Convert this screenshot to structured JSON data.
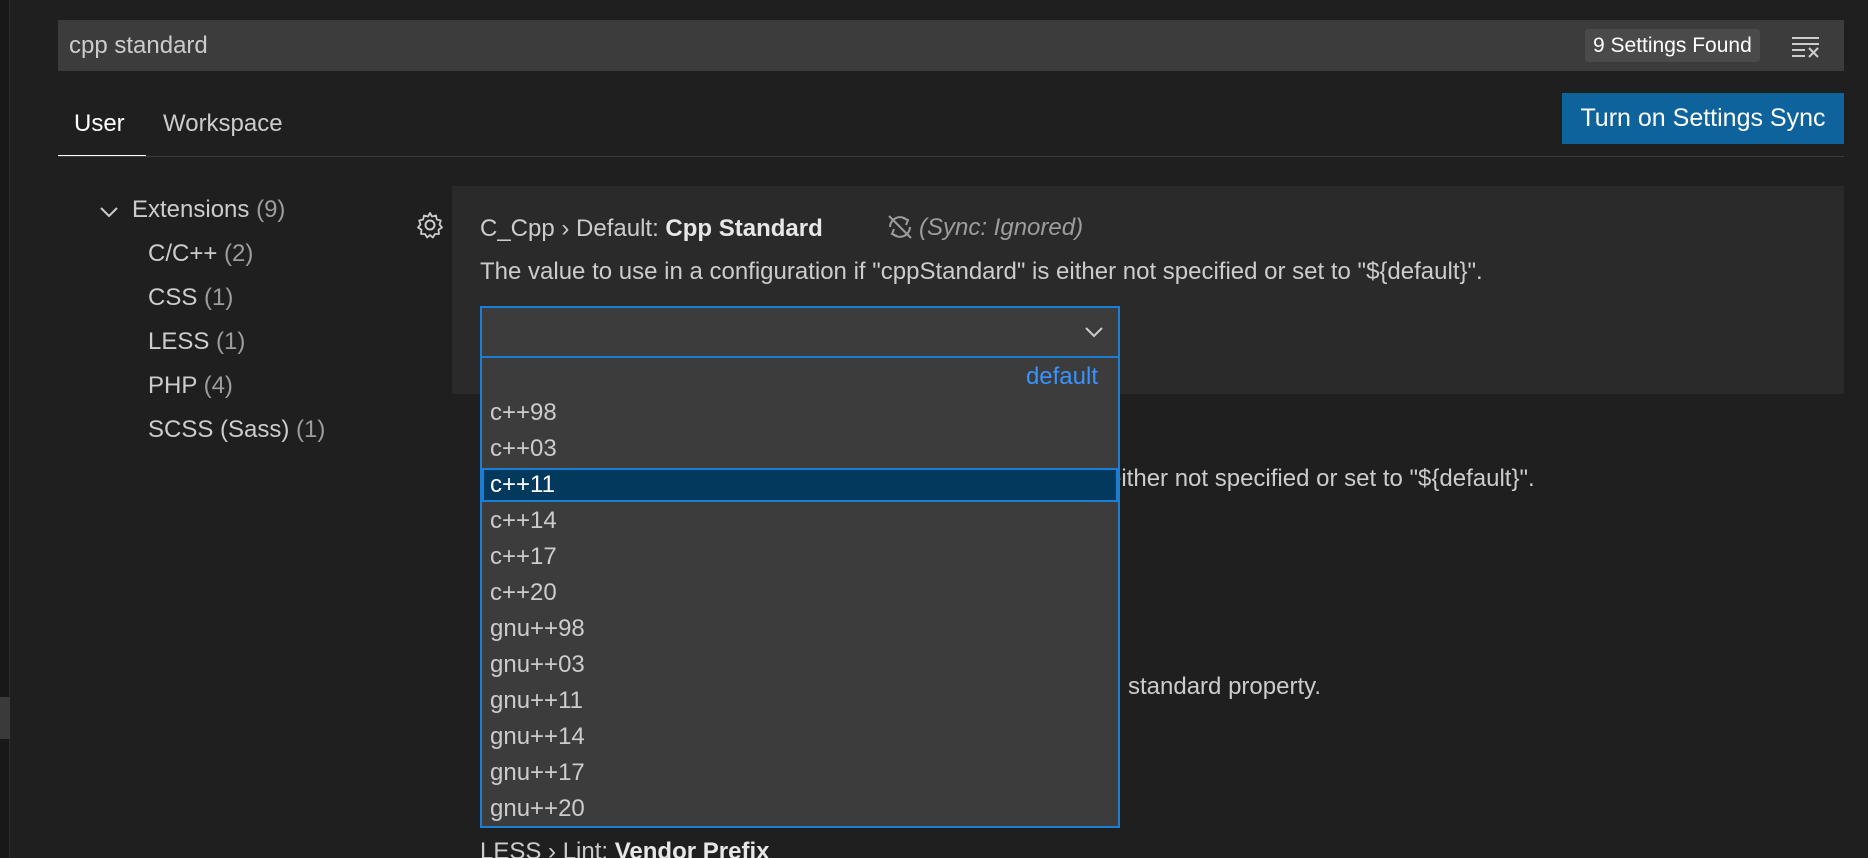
{
  "search": {
    "value": "cpp standard",
    "result_count": "9 Settings Found",
    "clear_icon": "clear-filter-icon"
  },
  "tabs": [
    {
      "label": "User",
      "active": true
    },
    {
      "label": "Workspace",
      "active": false
    }
  ],
  "sync_button_label": "Turn on Settings Sync",
  "toc": {
    "group": {
      "label": "Extensions",
      "count": "(9)"
    },
    "items": [
      {
        "label": "C/C++",
        "count": "(2)"
      },
      {
        "label": "CSS",
        "count": "(1)"
      },
      {
        "label": "LESS",
        "count": "(1)"
      },
      {
        "label": "PHP",
        "count": "(4)"
      },
      {
        "label": "SCSS (Sass)",
        "count": "(1)"
      }
    ]
  },
  "setting": {
    "category": "C_Cpp › Default: ",
    "name": "Cpp Standard",
    "sync_status": "(Sync: Ignored)",
    "description": "The value to use in a configuration if \"cppStandard\" is either not specified or set to \"${default}\"."
  },
  "dropdown": {
    "description_label": "default",
    "selected_index": 2,
    "options": [
      "c++98",
      "c++03",
      "c++11",
      "c++14",
      "c++17",
      "c++20",
      "gnu++98",
      "gnu++03",
      "gnu++11",
      "gnu++14",
      "gnu++17",
      "gnu++20"
    ]
  },
  "background": {
    "partial_desc_1": "either not specified or set to \"${default}\".",
    "partial_desc_2": "standard property.",
    "next_setting_category": "LESS › Lint: ",
    "next_setting_name": "Vendor Prefix"
  },
  "colors": {
    "accent": "#1a7fd4",
    "sync_button": "#0e639c",
    "selected_option": "#04395e",
    "link_blue": "#3794ff"
  }
}
